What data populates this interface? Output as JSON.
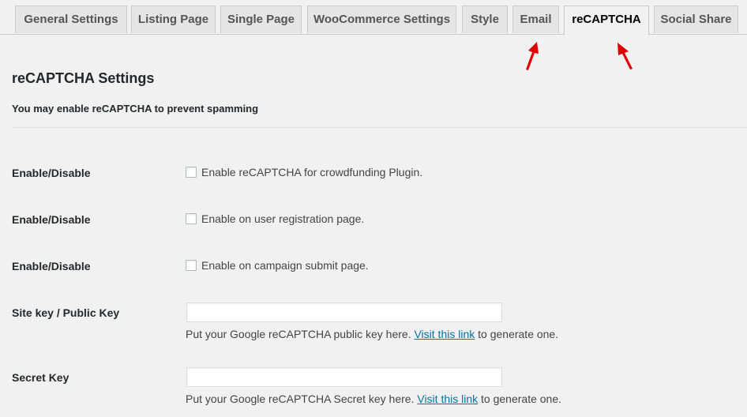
{
  "tabs": [
    {
      "label": "General Settings"
    },
    {
      "label": "Listing Page"
    },
    {
      "label": "Single Page"
    },
    {
      "label": "WooCommerce Settings"
    },
    {
      "label": "Style"
    },
    {
      "label": "Email"
    },
    {
      "label": "reCAPTCHA"
    },
    {
      "label": "Social Share"
    }
  ],
  "active_tab": "reCAPTCHA",
  "section": {
    "title": "reCAPTCHA Settings",
    "description": "You may enable reCAPTCHA to prevent spamming"
  },
  "rows": {
    "enable_plugin": {
      "label": "Enable/Disable",
      "checkbox_text": "Enable reCAPTCHA for crowdfunding Plugin.",
      "checked": false
    },
    "enable_registration": {
      "label": "Enable/Disable",
      "checkbox_text": "Enable on user registration page.",
      "checked": false
    },
    "enable_campaign": {
      "label": "Enable/Disable",
      "checkbox_text": "Enable on campaign submit page.",
      "checked": false
    },
    "site_key": {
      "label": "Site key / Public Key",
      "value": "",
      "help_before": "Put your Google reCAPTCHA public key here. ",
      "link_text": "Visit this link",
      "help_after": " to generate one."
    },
    "secret_key": {
      "label": "Secret Key",
      "value": "",
      "help_before": "Put your Google reCAPTCHA Secret key here. ",
      "link_text": "Visit this link",
      "help_after": " to generate one."
    }
  },
  "colors": {
    "background": "#f1f1f1",
    "tab_inactive": "#e5e5e5",
    "link": "#0073aa",
    "annotation_arrow": "#e00000"
  },
  "icons": [
    "annotation-arrow-icon",
    "checkbox-icon"
  ]
}
